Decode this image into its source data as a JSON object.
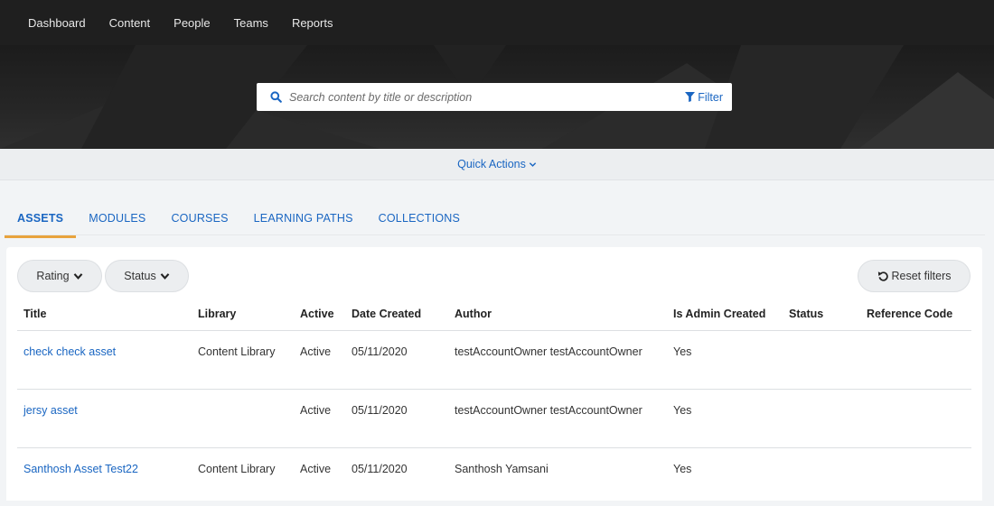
{
  "nav": {
    "items": [
      "Dashboard",
      "Content",
      "People",
      "Teams",
      "Reports"
    ]
  },
  "search": {
    "placeholder": "Search content by title or description",
    "filter_label": "Filter"
  },
  "quick_actions": {
    "label": "Quick Actions"
  },
  "tabs": [
    {
      "label": "ASSETS",
      "active": true
    },
    {
      "label": "MODULES",
      "active": false
    },
    {
      "label": "COURSES",
      "active": false
    },
    {
      "label": "LEARNING PATHS",
      "active": false
    },
    {
      "label": "COLLECTIONS",
      "active": false
    }
  ],
  "filters": {
    "rating_label": "Rating",
    "status_label": "Status",
    "reset_label": "Reset filters"
  },
  "table": {
    "columns": [
      "Title",
      "Library",
      "Active",
      "Date Created",
      "Author",
      "Is Admin Created",
      "Status",
      "Reference Code"
    ],
    "rows": [
      {
        "title": "check check asset",
        "library": "Content Library",
        "active": "Active",
        "date_created": "05/11/2020",
        "author": "testAccountOwner testAccountOwner",
        "is_admin_created": "Yes",
        "status": "",
        "reference_code": ""
      },
      {
        "title": "jersy asset",
        "library": "",
        "active": "Active",
        "date_created": "05/11/2020",
        "author": "testAccountOwner testAccountOwner",
        "is_admin_created": "Yes",
        "status": "",
        "reference_code": ""
      },
      {
        "title": "Santhosh Asset Test22",
        "library": "Content Library",
        "active": "Active",
        "date_created": "05/11/2020",
        "author": "Santhosh Yamsani",
        "is_admin_created": "Yes",
        "status": "",
        "reference_code": ""
      }
    ]
  },
  "colors": {
    "accent": "#1a66c2",
    "tab_underline": "#e8a33d",
    "nav_bg": "#1f1f1f"
  }
}
